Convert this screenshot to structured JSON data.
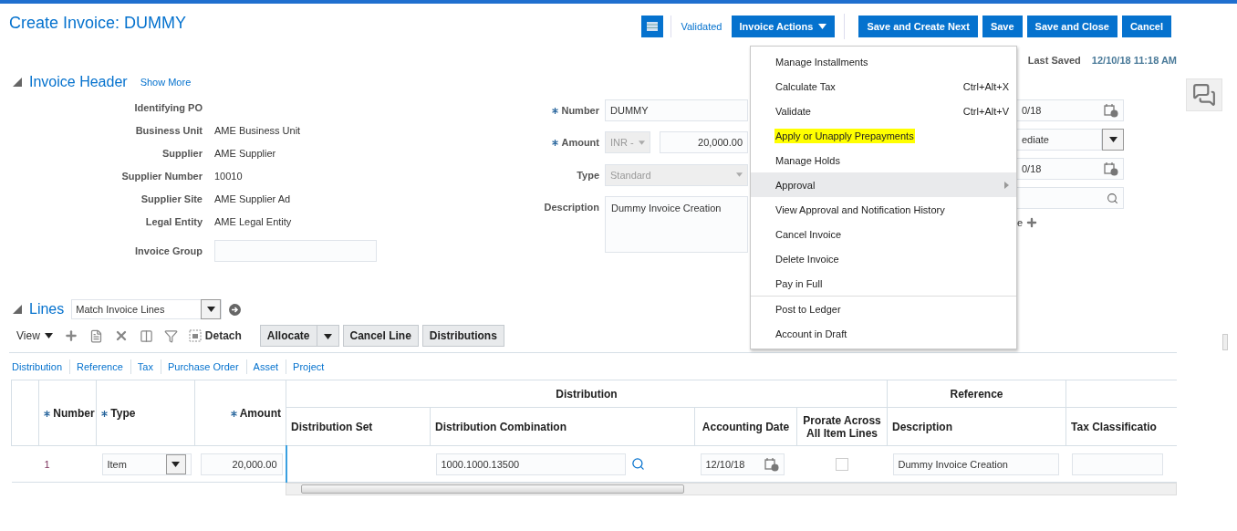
{
  "page_title": "Create Invoice: DUMMY",
  "toolbar": {
    "status": "Validated",
    "actions_menu": "Invoice Actions",
    "buttons": [
      "Save and Create Next",
      "Save",
      "Save and Close",
      "Cancel"
    ]
  },
  "actions_menu": {
    "open": true,
    "groups": [
      {
        "items": [
          {
            "label": "Manage Installments",
            "selected": false,
            "highlighted": false,
            "has_submenu": false
          },
          {
            "label": "Calculate Tax",
            "shortcut": "Ctrl+Alt+X",
            "selected": false,
            "highlighted": false,
            "has_submenu": false
          },
          {
            "label": "Validate",
            "shortcut": "Ctrl+Alt+V",
            "selected": false,
            "highlighted": false,
            "has_submenu": false
          },
          {
            "label": "Apply or Unapply Prepayments",
            "selected": false,
            "highlighted": true,
            "has_submenu": false
          },
          {
            "label": "Manage Holds",
            "selected": false,
            "highlighted": false,
            "has_submenu": false
          },
          {
            "label": "Approval",
            "selected": true,
            "highlighted": false,
            "has_submenu": true
          },
          {
            "label": "View Approval and Notification History",
            "selected": false,
            "highlighted": false,
            "has_submenu": false
          },
          {
            "label": "Cancel Invoice",
            "selected": false,
            "highlighted": false,
            "has_submenu": false
          },
          {
            "label": "Delete Invoice",
            "selected": false,
            "highlighted": false,
            "has_submenu": false
          },
          {
            "label": "Pay in Full",
            "selected": false,
            "highlighted": false,
            "has_submenu": false
          }
        ]
      },
      {
        "items": [
          {
            "label": "Post to Ledger",
            "selected": false,
            "highlighted": false,
            "has_submenu": false
          },
          {
            "label": "Account in Draft",
            "selected": false,
            "highlighted": false,
            "has_submenu": false
          }
        ]
      }
    ]
  },
  "last_saved": {
    "label": "Last Saved",
    "value": "12/10/18 11:18 AM"
  },
  "invoice_header": {
    "title": "Invoice Header",
    "expanded": true,
    "show_more": "Show More",
    "left_fields": [
      {
        "label": "Identifying PO",
        "kind": "text"
      },
      {
        "label": "Business Unit",
        "kind": "text",
        "value": "AME Business Unit"
      },
      {
        "label": "Supplier",
        "kind": "text",
        "value": "AME Supplier"
      },
      {
        "label": "Supplier Number",
        "kind": "text",
        "value": "10010"
      },
      {
        "label": "Supplier Site",
        "kind": "text",
        "value": "AME Supplier Ad"
      },
      {
        "label": "Legal Entity",
        "kind": "text",
        "value": "AME Legal Entity"
      },
      {
        "label": "Invoice Group",
        "kind": "input"
      }
    ],
    "middle_fields": [
      {
        "label": "Number",
        "required": true,
        "kind": "input",
        "value": "DUMMY"
      },
      {
        "label": "Amount",
        "required": true,
        "kind": "amount",
        "currency": "INR -",
        "currency_disabled": true,
        "value": "20,000.00"
      },
      {
        "label": "Type",
        "required": false,
        "kind": "select",
        "value": "Standard",
        "disabled": true
      },
      {
        "label": "Description",
        "required": false,
        "kind": "textarea",
        "value": "Dummy Invoice Creation"
      }
    ],
    "right_fields": [
      {
        "kind": "date",
        "value": "0/18"
      },
      {
        "kind": "select",
        "value": "ediate"
      },
      {
        "kind": "date",
        "value": "0/18"
      },
      {
        "kind": "search"
      },
      {
        "kind": "add",
        "label": "e"
      }
    ]
  },
  "lines": {
    "title": "Lines",
    "expanded": true,
    "match_select": "Match Invoice Lines",
    "toolbar": {
      "view": "View",
      "detach": "Detach",
      "allocate": "Allocate",
      "buttons": [
        "Cancel Line",
        "Distributions"
      ]
    },
    "tabs": [
      "Distribution",
      "Reference",
      "Tax",
      "Purchase Order",
      "Asset",
      "Project"
    ],
    "table": {
      "groups": [
        {
          "label": "Distribution"
        },
        {
          "label": "Reference"
        }
      ],
      "columns": [
        {
          "label": "Number",
          "required": true
        },
        {
          "label": "Type",
          "required": true
        },
        {
          "label": "Amount",
          "required": true
        },
        {
          "label": "Distribution Set",
          "required": false
        },
        {
          "label": "Distribution Combination",
          "required": false
        },
        {
          "label": "Accounting Date",
          "required": false
        },
        {
          "label": "Prorate Across All Item Lines",
          "required": false
        },
        {
          "label": "Description",
          "required": false
        },
        {
          "label": "Tax Classificatio",
          "required": false
        }
      ],
      "rows": [
        {
          "number": "1",
          "type": "Item",
          "amount": "20,000.00",
          "distribution_combination": "1000.1000.13500",
          "accounting_date": "12/10/18",
          "prorate": false,
          "description": "Dummy Invoice Creation"
        }
      ]
    }
  }
}
